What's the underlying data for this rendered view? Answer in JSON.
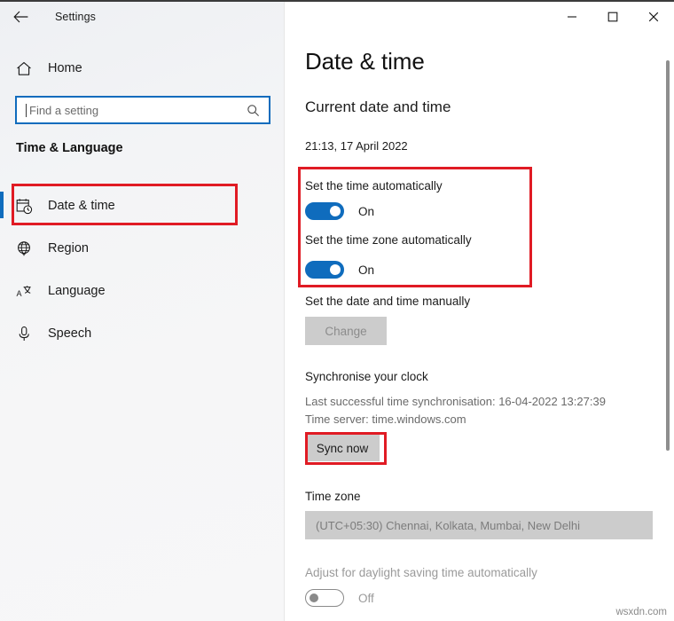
{
  "window": {
    "title": "Settings",
    "back_icon": "back-arrow-icon",
    "controls": {
      "minimize": "minimize-icon",
      "maximize": "maximize-icon",
      "close": "close-icon"
    }
  },
  "sidebar": {
    "home": {
      "label": "Home",
      "icon": "home-icon"
    },
    "search": {
      "placeholder": "Find a setting",
      "value": "",
      "icon": "search-icon"
    },
    "category": "Time & Language",
    "items": [
      {
        "label": "Date & time",
        "icon": "calendar-clock-icon",
        "selected": true
      },
      {
        "label": "Region",
        "icon": "globe-icon",
        "selected": false
      },
      {
        "label": "Language",
        "icon": "language-icon",
        "selected": false
      },
      {
        "label": "Speech",
        "icon": "microphone-icon",
        "selected": false
      }
    ]
  },
  "main": {
    "page_title": "Date & time",
    "current_section": {
      "heading": "Current date and time",
      "datetime": "21:13, 17 April 2022"
    },
    "auto_time": {
      "label": "Set the time automatically",
      "state": "On",
      "enabled": true
    },
    "auto_timezone": {
      "label": "Set the time zone automatically",
      "state": "On",
      "enabled": true
    },
    "manual": {
      "label": "Set the date and time manually",
      "button": "Change",
      "disabled": true
    },
    "sync": {
      "heading": "Synchronise your clock",
      "last_sync": "Last successful time synchronisation: 16-04-2022 13:27:39",
      "time_server": "Time server: time.windows.com",
      "button": "Sync now"
    },
    "timezone": {
      "label": "Time zone",
      "value": "(UTC+05:30) Chennai, Kolkata, Mumbai, New Delhi",
      "disabled": true
    },
    "dst": {
      "label": "Adjust for daylight saving time automatically",
      "state": "Off",
      "enabled": false
    }
  },
  "annotations": {
    "highlight_color": "#e01b24",
    "boxes": [
      "auto-time-toggles",
      "sync-now-button",
      "date-time-nav-item"
    ]
  },
  "accent_color": "#0f6cbd",
  "watermark": "wsxdn.com"
}
